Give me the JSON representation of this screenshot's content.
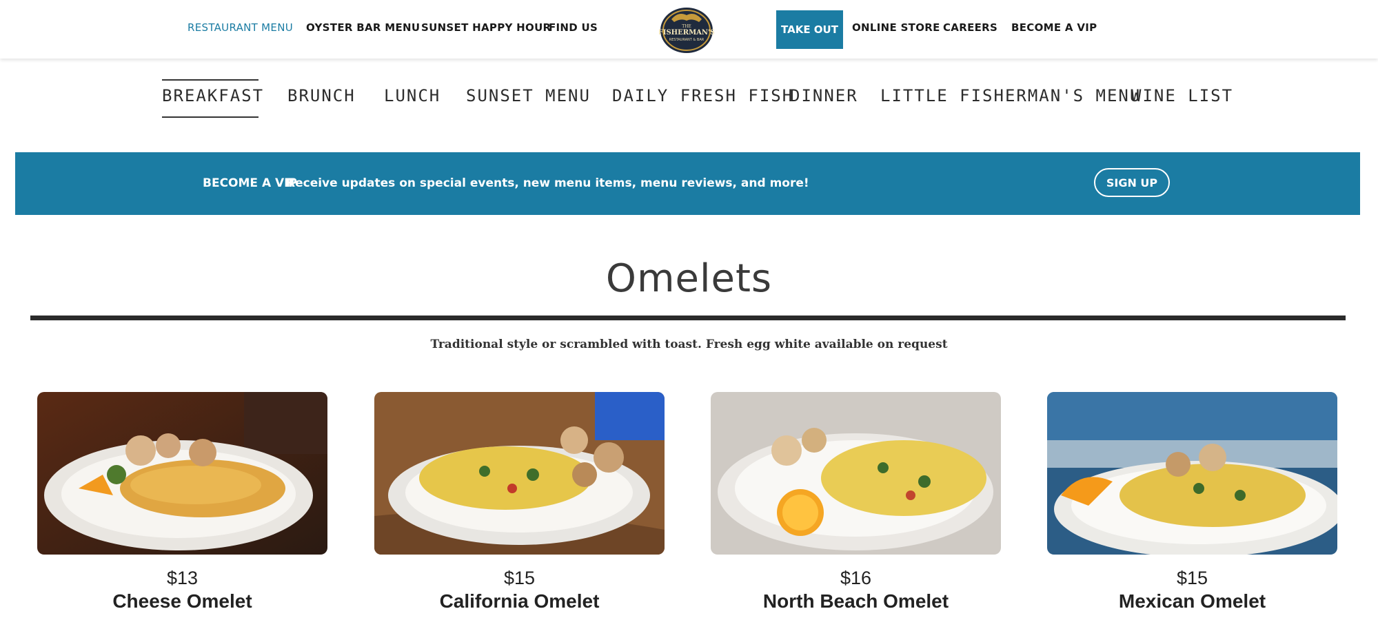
{
  "topnav": {
    "left": [
      "RESTAURANT MENU",
      "OYSTER BAR MENU",
      "SUNSET HAPPY HOUR",
      "FIND US"
    ],
    "takeout": "TAKE OUT",
    "right": [
      "ONLINE STORE",
      "CAREERS",
      "BECOME A VIP"
    ]
  },
  "logo": {
    "line1": "THE",
    "line2": "FISHERMAN'S",
    "line3": "RESTAURANT & BAR"
  },
  "categories": [
    "BREAKFAST",
    "BRUNCH",
    "LUNCH",
    "SUNSET MENU",
    "DAILY FRESH FISH",
    "DINNER",
    "LITTLE FISHERMAN'S MENU",
    "WINE LIST"
  ],
  "vip": {
    "title": "BECOME A VIP",
    "text": "Receive updates on special events, new menu items, menu reviews, and more!",
    "button": "SIGN UP"
  },
  "section": {
    "title": "Omelets",
    "subtitle": "Traditional style or scrambled with toast. Fresh egg white available on request"
  },
  "items": [
    {
      "price": "$13",
      "name": "Cheese Omelet"
    },
    {
      "price": "$15",
      "name": "California Omelet"
    },
    {
      "price": "$16",
      "name": "North Beach Omelet"
    },
    {
      "price": "$15",
      "name": "Mexican Omelet"
    }
  ],
  "colors": {
    "accent": "#1b7ca3",
    "dark": "#2b2b2b"
  }
}
